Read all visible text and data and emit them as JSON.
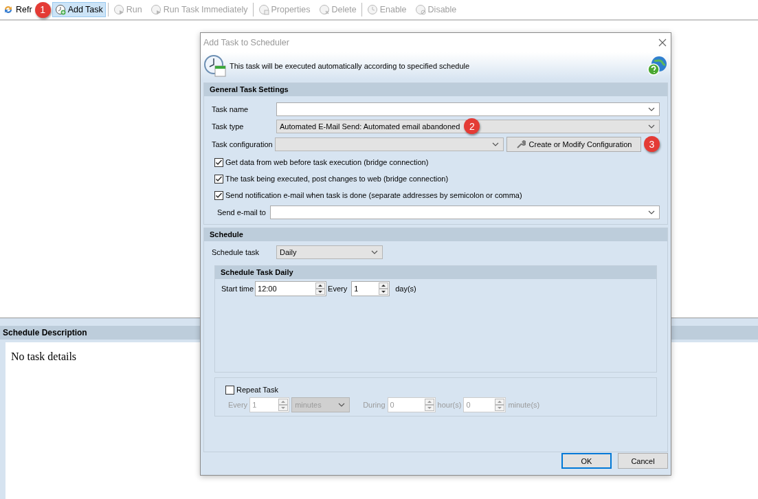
{
  "toolbar": {
    "groups": [
      [
        {
          "label": "Refr",
          "kind": "refresh",
          "disabled": false,
          "selected": false,
          "callout": "1"
        },
        {
          "label": "Add Task",
          "kind": "add",
          "disabled": false,
          "selected": true
        }
      ],
      [
        {
          "label": "Run",
          "kind": "run",
          "disabled": true,
          "selected": false
        },
        {
          "label": "Run Task Immediately",
          "kind": "run",
          "disabled": true,
          "selected": false
        }
      ],
      [
        {
          "label": "Properties",
          "kind": "properties",
          "disabled": true,
          "selected": false
        },
        {
          "label": "Delete",
          "kind": "delete",
          "disabled": true,
          "selected": false
        }
      ],
      [
        {
          "label": "Enable",
          "kind": "enable",
          "disabled": true,
          "selected": false
        },
        {
          "label": "Disable",
          "kind": "disable",
          "disabled": true,
          "selected": false
        }
      ]
    ]
  },
  "schedule_description": {
    "title": "Schedule Description",
    "text": "No task details"
  },
  "dialog": {
    "title": "Add Task to Scheduler",
    "info": "This task will be executed automatically according to specified schedule",
    "general": {
      "title": "General Task Settings",
      "task_name": {
        "label": "Task name"
      },
      "task_type": {
        "label": "Task type",
        "value": "Automated E-Mail Send: Automated email abandoned",
        "callout": "2"
      },
      "task_configuration": {
        "label": "Task configuration"
      },
      "configure_button": {
        "label": "Create or Modify Configuration",
        "callout": "3"
      },
      "options": [
        {
          "label": "Get data from web before task execution (bridge connection)",
          "checked": true
        },
        {
          "label": "The task being executed, post changes to web (bridge connection)",
          "checked": true
        },
        {
          "label": "Send notification e-mail when task is done (separate addresses by semicolon or comma)",
          "checked": true
        }
      ],
      "send_email": {
        "label": "Send e-mail to"
      }
    },
    "schedule": {
      "title": "Schedule",
      "schedule_task": {
        "label": "Schedule task",
        "value": "Daily"
      },
      "daily": {
        "title": "Schedule Task Daily",
        "start_time": {
          "label": "Start time",
          "value": "12:00"
        },
        "every": {
          "label": "Every",
          "value": "1",
          "unit": "day(s)"
        }
      },
      "repeat": {
        "label": "Repeat Task",
        "checked": false,
        "every_label": "Every",
        "every_value": "1",
        "every_unit": "minutes",
        "during_label": "During",
        "hours": "0",
        "hours_unit": "hour(s)",
        "minutes": "0",
        "minutes_unit": "minute(s)"
      }
    },
    "buttons": [
      {
        "label": "OK",
        "default": true
      },
      {
        "label": "Cancel",
        "default": false
      }
    ]
  }
}
